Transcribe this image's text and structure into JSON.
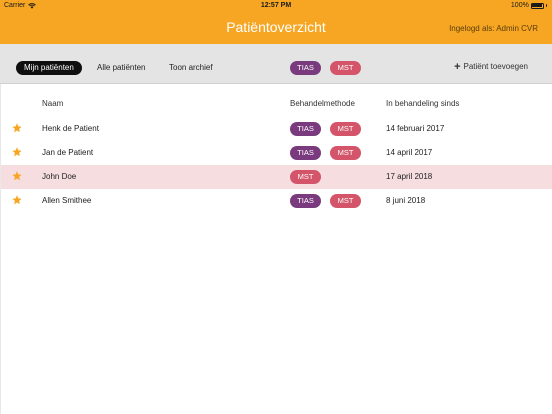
{
  "status_bar": {
    "carrier": "Carrier",
    "time": "12:57 PM",
    "battery": "100%"
  },
  "header": {
    "title": "Patiëntoverzicht",
    "logged_in": "Ingelogd als: Admin CVR"
  },
  "toolbar": {
    "tabs": [
      {
        "label": "Mijn patiënten",
        "active": true
      },
      {
        "label": "Alle patiënten",
        "active": false
      },
      {
        "label": "Toon archief",
        "active": false
      }
    ],
    "filters": [
      "TIAS",
      "MST"
    ],
    "add_label": "Patiënt toevoegen"
  },
  "table": {
    "columns": [
      "Naam",
      "Behandelmethode",
      "In behandeling sinds"
    ],
    "rows": [
      {
        "name": "Henk de Patient",
        "methods": [
          "TIAS",
          "MST"
        ],
        "since": "14 februari 2017",
        "starred": true,
        "selected": false
      },
      {
        "name": "Jan de Patient",
        "methods": [
          "TIAS",
          "MST"
        ],
        "since": "14 april 2017",
        "starred": true,
        "selected": false
      },
      {
        "name": "John Doe",
        "methods": [
          "MST"
        ],
        "since": "17 april 2018",
        "starred": true,
        "selected": true
      },
      {
        "name": "Allen Smithee",
        "methods": [
          "TIAS",
          "MST"
        ],
        "since": "8 juni 2018",
        "starred": true,
        "selected": false
      }
    ]
  },
  "colors": {
    "header": "#f6a623",
    "tias": "#7a3b7e",
    "mst": "#d4546a",
    "star": "#f6a623",
    "selected_row": "#f6dde0"
  },
  "icons": {
    "wifi": "wifi-icon",
    "battery": "battery-icon",
    "add": "plus-icon",
    "star": "star-icon"
  }
}
